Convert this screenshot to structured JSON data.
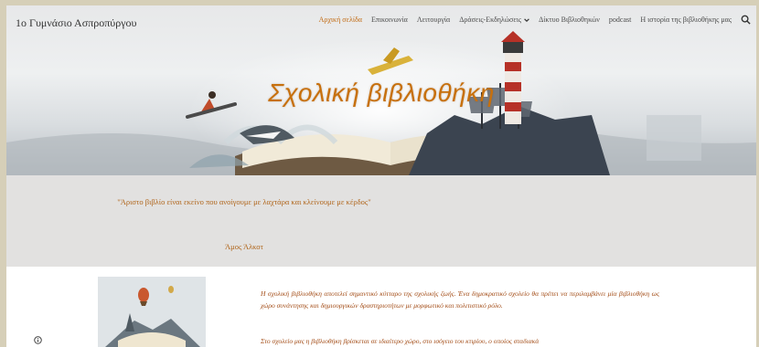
{
  "site": {
    "title": "1ο Γυμνάσιο Ασπροπύργου"
  },
  "nav": {
    "items": [
      "Αρχική σελίδα",
      "Επικοινωνία",
      "Λειτουργία",
      "Δράσεις-Εκδηλώσεις",
      "Δίκτυο Βιβλιοθηκών",
      "podcast",
      "Η ιστορία της βιβλιοθήκης μας"
    ],
    "active_index": 0,
    "dropdown_index": 3
  },
  "hero": {
    "title": "Σχολική βιβλιοθήκη"
  },
  "quote": {
    "text": "\"Άριστο βιβλίο είναι εκείνο που ανοίγουμε με λαχτάρα και  κλείνουμε με κέρδος\"",
    "author": "Άμος Άλκοτ"
  },
  "content": {
    "paragraph1": "Η σχολική βιβλιοθήκη αποτελεί σημαντικό κύτταρο της σχολικής ζωής. Ένα δημοκρατικό σχολείο θα πρέπει να περιλαμβάνει μία βιβλιοθήκη ως χώρο συνάντησης και δημιουργικών δραστηριοτήτων με μορφωτικό και πολιτιστικό ρόλο.",
    "paragraph2": "Στο σχολείο μας η βιβλιοθήκη βρίσκεται σε ιδιαίτερο χώρο, στο ισόγειο του κτιρίου, ο οποίος σταδιακά"
  },
  "colors": {
    "accent": "#c7700d",
    "nav_active": "#c26a12",
    "quote_text": "#b0651a",
    "paragraph_text": "#a24b15",
    "quote_band": "#e2e1e0",
    "outer_background": "#d6cfb8"
  },
  "icons": {
    "search": "search-icon",
    "dropdown": "chevron-down-icon",
    "info": "info-icon"
  }
}
